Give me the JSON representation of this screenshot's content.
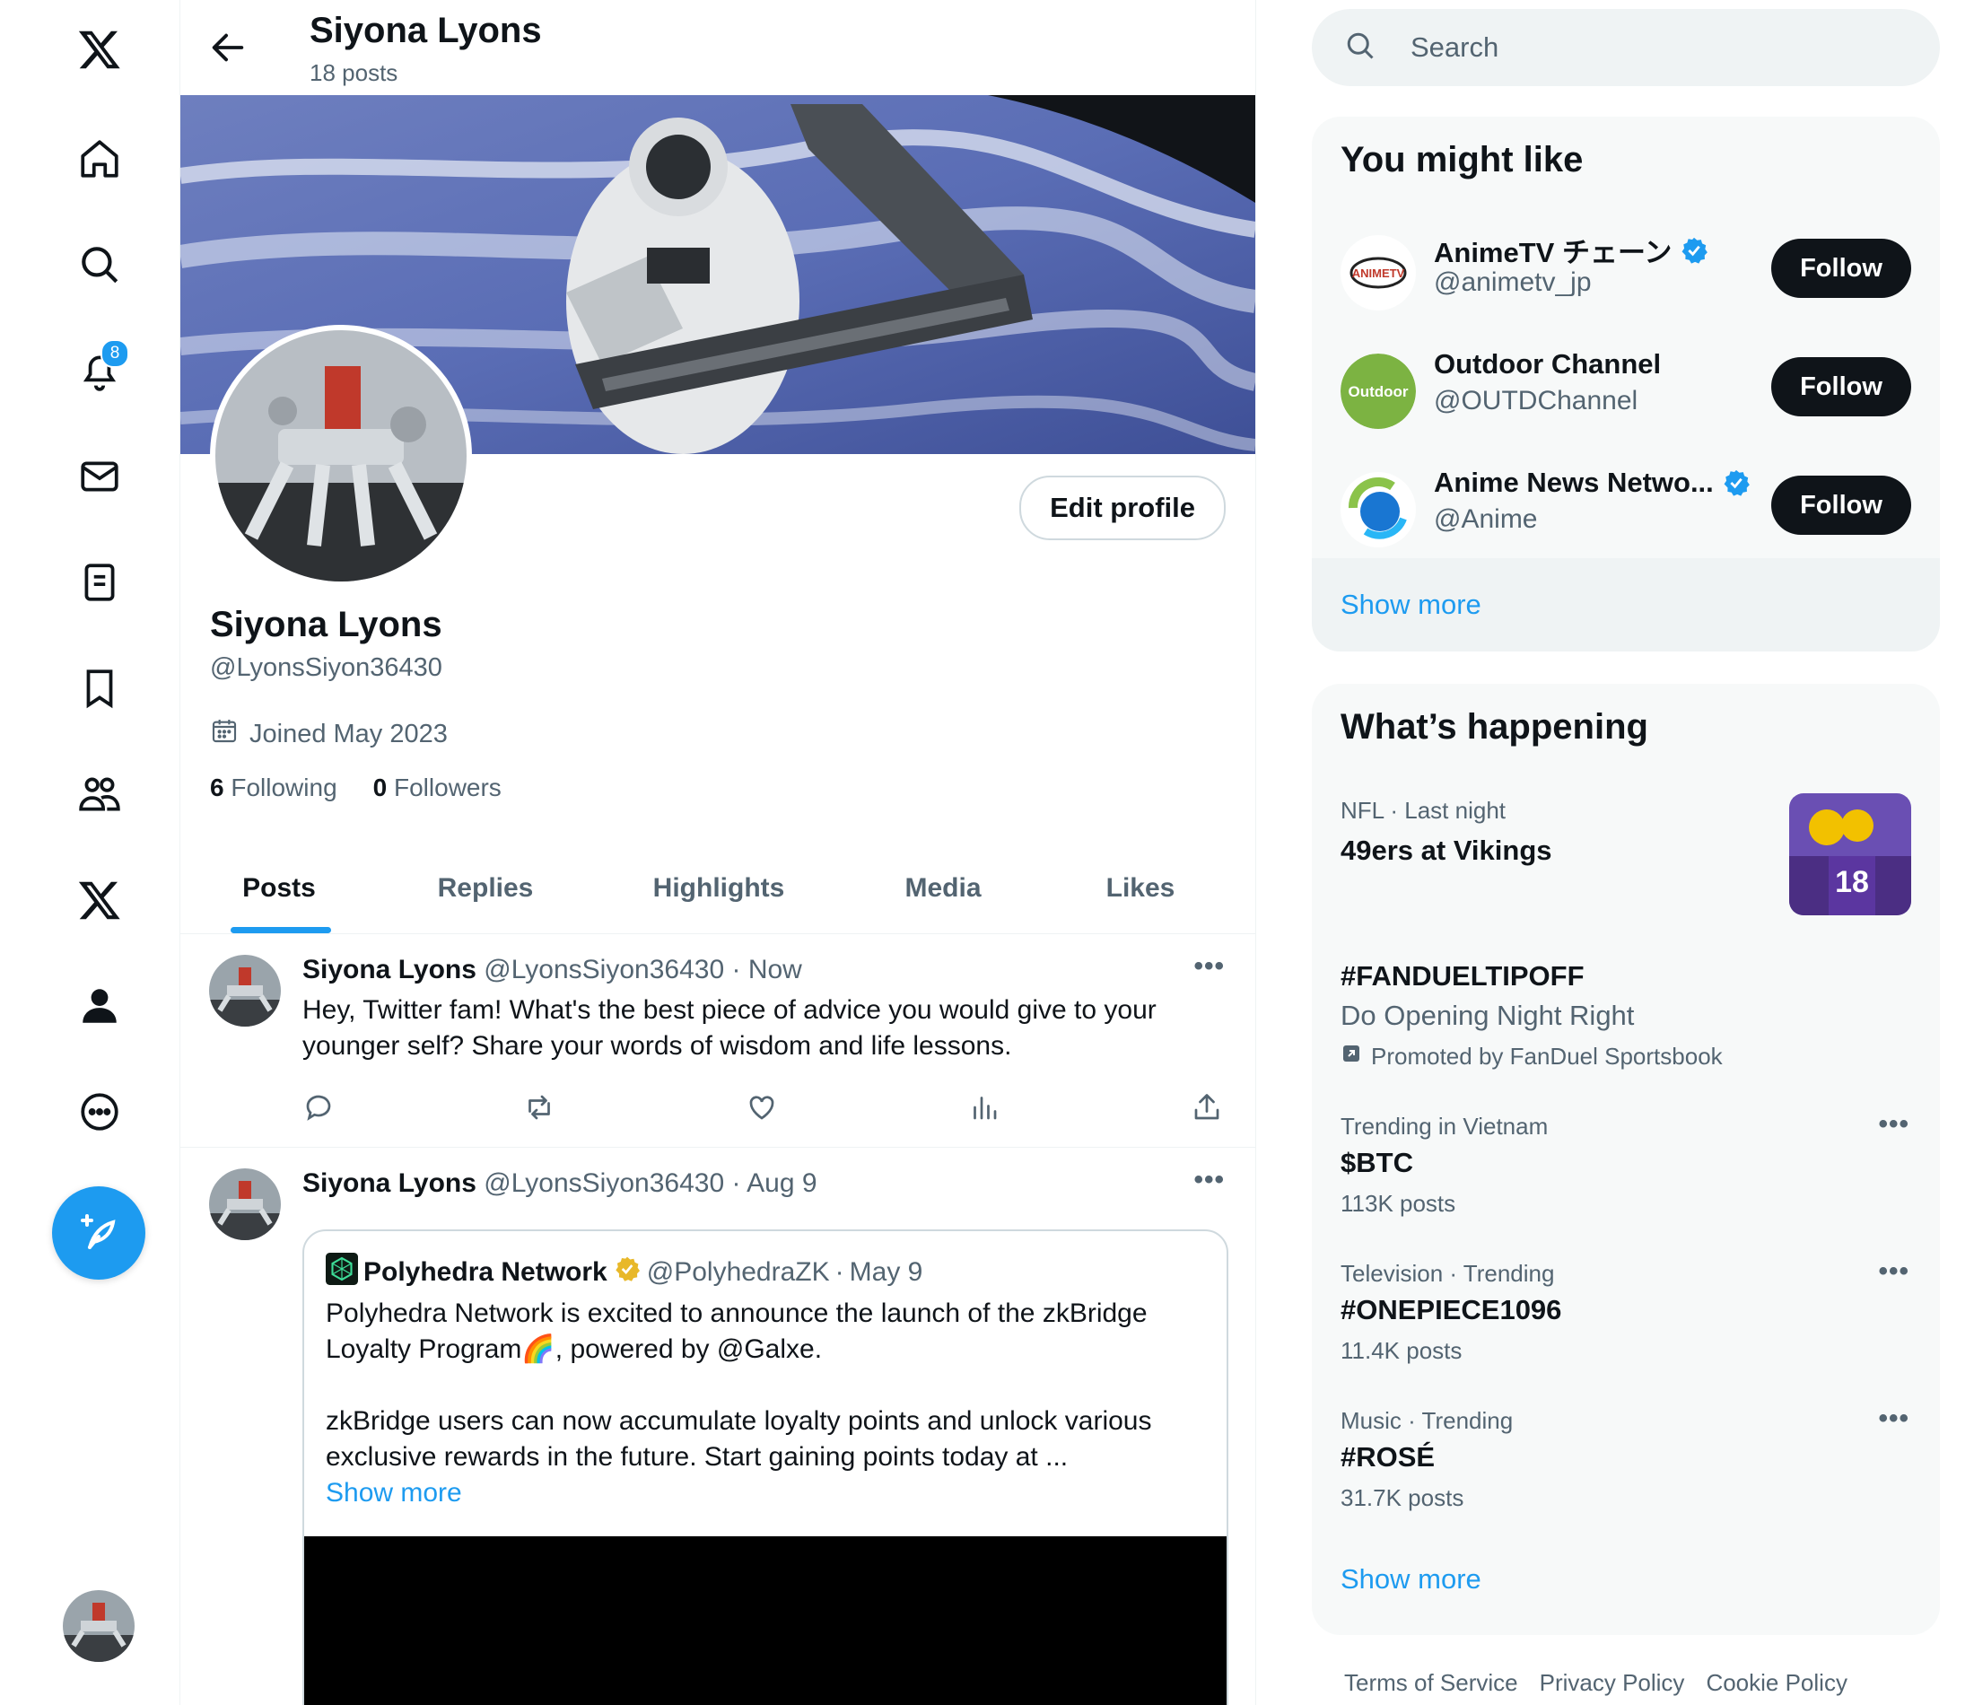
{
  "header": {
    "name": "Siyona Lyons",
    "posts_count": "18 posts"
  },
  "nav": {
    "notifications_badge": "8"
  },
  "profile": {
    "edit_button": "Edit profile",
    "name": "Siyona Lyons",
    "handle": "@LyonsSiyon36430",
    "joined": "Joined May 2023",
    "following_count": "6",
    "following_label": "Following",
    "followers_count": "0",
    "followers_label": "Followers"
  },
  "tabs": [
    {
      "label": "Posts",
      "active": true
    },
    {
      "label": "Replies"
    },
    {
      "label": "Highlights"
    },
    {
      "label": "Media"
    },
    {
      "label": "Likes"
    }
  ],
  "posts": [
    {
      "author": "Siyona Lyons",
      "handle": "@LyonsSiyon36430",
      "time": "Now",
      "text": "Hey, Twitter fam! What's the best piece of advice you would give to your younger self? Share your words of wisdom and life lessons."
    },
    {
      "author": "Siyona Lyons",
      "handle": "@LyonsSiyon36430",
      "time": "Aug 9",
      "quote": {
        "author": "Polyhedra Network",
        "handle": "@PolyhedraZK",
        "time": "May 9",
        "text1": "Polyhedra Network is excited to announce the launch of the zkBridge Loyalty Program🌈, powered by @Galxe.",
        "text2": "zkBridge users can now accumulate loyalty points and unlock various exclusive rewards in the future. Start gaining points today at ...",
        "show_more": "Show more"
      }
    }
  ],
  "search": {
    "placeholder": "Search"
  },
  "suggestions": {
    "title": "You might like",
    "items": [
      {
        "name": "AnimeTV チェーン",
        "handle": "@animetv_jp",
        "verified": true,
        "button": "Follow"
      },
      {
        "name": "Outdoor Channel",
        "handle": "@OUTDChannel",
        "verified": false,
        "button": "Follow"
      },
      {
        "name": "Anime News Netwo...",
        "handle": "@Anime",
        "verified": true,
        "button": "Follow"
      }
    ],
    "show_more": "Show more"
  },
  "trends": {
    "title": "What’s happening",
    "items": [
      {
        "meta": "NFL · Last night",
        "title": "49ers at Vikings"
      },
      {
        "title": "#FANDUELTIPOFF",
        "subtitle": "Do Opening Night Right",
        "promoted": "Promoted by FanDuel Sportsbook"
      },
      {
        "meta": "Trending in Vietnam",
        "title": "$BTC",
        "count": "113K posts"
      },
      {
        "meta": "Television · Trending",
        "title": "#ONEPIECE1096",
        "count": "11.4K posts"
      },
      {
        "meta": "Music · Trending",
        "title": "#ROSÉ",
        "count": "31.7K posts"
      }
    ],
    "show_more": "Show more"
  },
  "footer": {
    "links": [
      "Terms of Service",
      "Privacy Policy",
      "Cookie Policy"
    ]
  },
  "colors": {
    "accent": "#1d9bf0",
    "text": "#0f1419",
    "secondary": "#536471",
    "follow_button": "#0f1419"
  }
}
